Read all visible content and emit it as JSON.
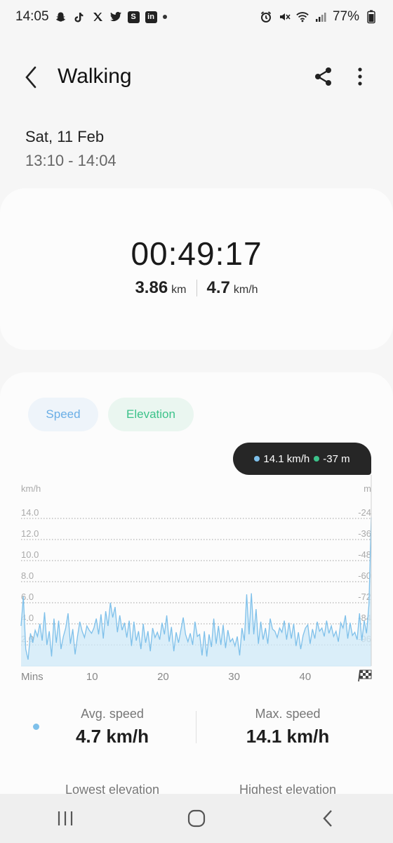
{
  "status_bar": {
    "time": "14:05",
    "battery": "77%",
    "icons": [
      "snapchat-icon",
      "tiktok-icon",
      "x-icon",
      "twitter-icon",
      "s-app-icon",
      "linkedin-icon",
      "dot-icon",
      "alarm-icon",
      "mute-icon",
      "wifi-icon",
      "signal-icon",
      "battery-icon"
    ]
  },
  "header": {
    "title": "Walking"
  },
  "session": {
    "date": "Sat, 11 Feb",
    "time_range": "13:10 - 14:04"
  },
  "summary": {
    "duration": "00:49:17",
    "distance_value": "3.86",
    "distance_unit": "km",
    "speed_value": "4.7",
    "speed_unit": "km/h"
  },
  "chart": {
    "tabs": [
      "Speed",
      "Elevation"
    ],
    "tooltip": {
      "speed": "14.1 km/h",
      "elevation": "-37 m"
    },
    "left_unit": "km/h",
    "right_unit": "m",
    "y_left_ticks": [
      "14.0",
      "12.0",
      "10.0",
      "8.0",
      "6.0",
      "4.0",
      "2.0"
    ],
    "y_right_ticks": [
      "-24",
      "-36",
      "-48",
      "-60",
      "-72",
      "-84",
      "-96"
    ],
    "x_ticks": [
      "Mins",
      "10",
      "20",
      "30",
      "40"
    ],
    "colors": {
      "speed": "#7ec0ea",
      "speed_fill": "#cfe9f8",
      "elevation": "#3cc28a",
      "grid": "#a0a0a0"
    }
  },
  "chart_data": {
    "type": "area",
    "xlabel": "Mins",
    "ylabel": "km/h",
    "xlim": [
      0,
      49.3
    ],
    "ylim": [
      0,
      16
    ],
    "x_ticks": [
      10,
      20,
      30,
      40
    ],
    "y_ticks": [
      2,
      4,
      6,
      8,
      10,
      12,
      14
    ],
    "y2_label": "m",
    "y2_ticks": [
      -96,
      -84,
      -72,
      -60,
      -48,
      -36,
      -24
    ],
    "series": [
      {
        "name": "Speed",
        "y": [
          3.8,
          6.6,
          1.6,
          0.6,
          3.1,
          2.2,
          3.4,
          2.8,
          4.0,
          2.4,
          5.1,
          2.0,
          3.3,
          0.9,
          4.5,
          2.2,
          4.3,
          1.6,
          2.8,
          3.6,
          5.0,
          2.1,
          3.5,
          1.1,
          2.8,
          4.2,
          3.3,
          2.7,
          3.8,
          3.4,
          3.1,
          3.6,
          4.5,
          3.0,
          4.9,
          2.6,
          5.2,
          3.8,
          6.0,
          4.6,
          5.6,
          3.2,
          4.8,
          3.4,
          4.1,
          2.7,
          4.3,
          1.9,
          4.2,
          2.4,
          3.3,
          1.6,
          4.0,
          2.2,
          3.3,
          1.4,
          3.6,
          2.7,
          3.2,
          2.5,
          4.1,
          3.0,
          4.8,
          2.3,
          3.7,
          1.4,
          3.2,
          2.2,
          3.4,
          4.6,
          3.0,
          2.3,
          3.1,
          2.0,
          4.2,
          2.8,
          3.0,
          1.0,
          3.3,
          0.9,
          3.0,
          1.8,
          4.5,
          2.1,
          3.8,
          2.0,
          3.9,
          1.7,
          3.4,
          2.3,
          2.6,
          1.9,
          2.8,
          1.0,
          3.6,
          2.4,
          6.8,
          3.0,
          6.9,
          3.0,
          5.4,
          2.1,
          4.2,
          2.5,
          3.6,
          2.1,
          4.5,
          3.5,
          3.3,
          2.7,
          3.6,
          3.2,
          4.3,
          2.5,
          4.1,
          2.6,
          4.0,
          1.9,
          3.2,
          1.6,
          2.9,
          3.6,
          3.9,
          2.1,
          3.5,
          2.6,
          4.2,
          3.3,
          3.6,
          2.8,
          4.3,
          3.1,
          3.8,
          2.8,
          3.3,
          2.3,
          4.1,
          3.6,
          4.8,
          2.6,
          4.1,
          2.9,
          3.2,
          2.5,
          5.0,
          2.4,
          4.3,
          3.1,
          5.8,
          14.1
        ]
      }
    ],
    "max_highlight": {
      "x": 49.3,
      "speed": "14.1 km/h",
      "elevation": "-37 m"
    }
  },
  "stats": {
    "avg_speed_label": "Avg. speed",
    "avg_speed_value": "4.7 km/h",
    "max_speed_label": "Max. speed",
    "max_speed_value": "14.1 km/h",
    "lowest_elevation_label": "Lowest elevation",
    "highest_elevation_label": "Highest elevation"
  }
}
